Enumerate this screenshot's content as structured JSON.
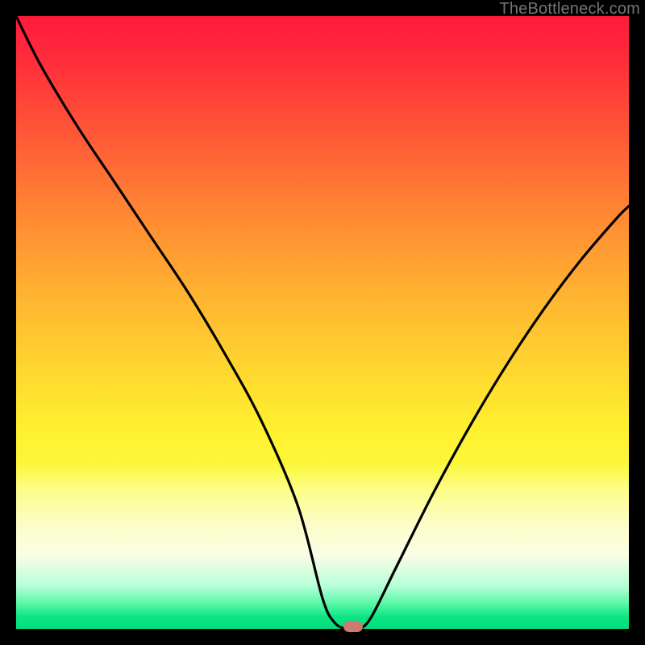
{
  "watermark": "TheBottleneck.com",
  "chart_data": {
    "type": "line",
    "title": "",
    "xlabel": "",
    "ylabel": "",
    "xlim": [
      0,
      100
    ],
    "ylim": [
      0,
      100
    ],
    "series": [
      {
        "name": "bottleneck-curve",
        "x": [
          0,
          4,
          10,
          16,
          22,
          28,
          34,
          40,
          46,
          50,
          52,
          54,
          56,
          58,
          62,
          68,
          74,
          80,
          86,
          92,
          98,
          100
        ],
        "values": [
          100,
          92,
          82,
          73,
          64,
          55,
          45,
          34,
          20,
          5,
          1,
          0,
          0,
          2,
          10,
          22,
          33,
          43,
          52,
          60,
          67,
          69
        ]
      }
    ],
    "marker": {
      "x": 55,
      "y": 0
    },
    "background_gradient": {
      "top": "#ff1a3c",
      "mid": "#fff02f",
      "bottom": "#00de7e"
    }
  }
}
